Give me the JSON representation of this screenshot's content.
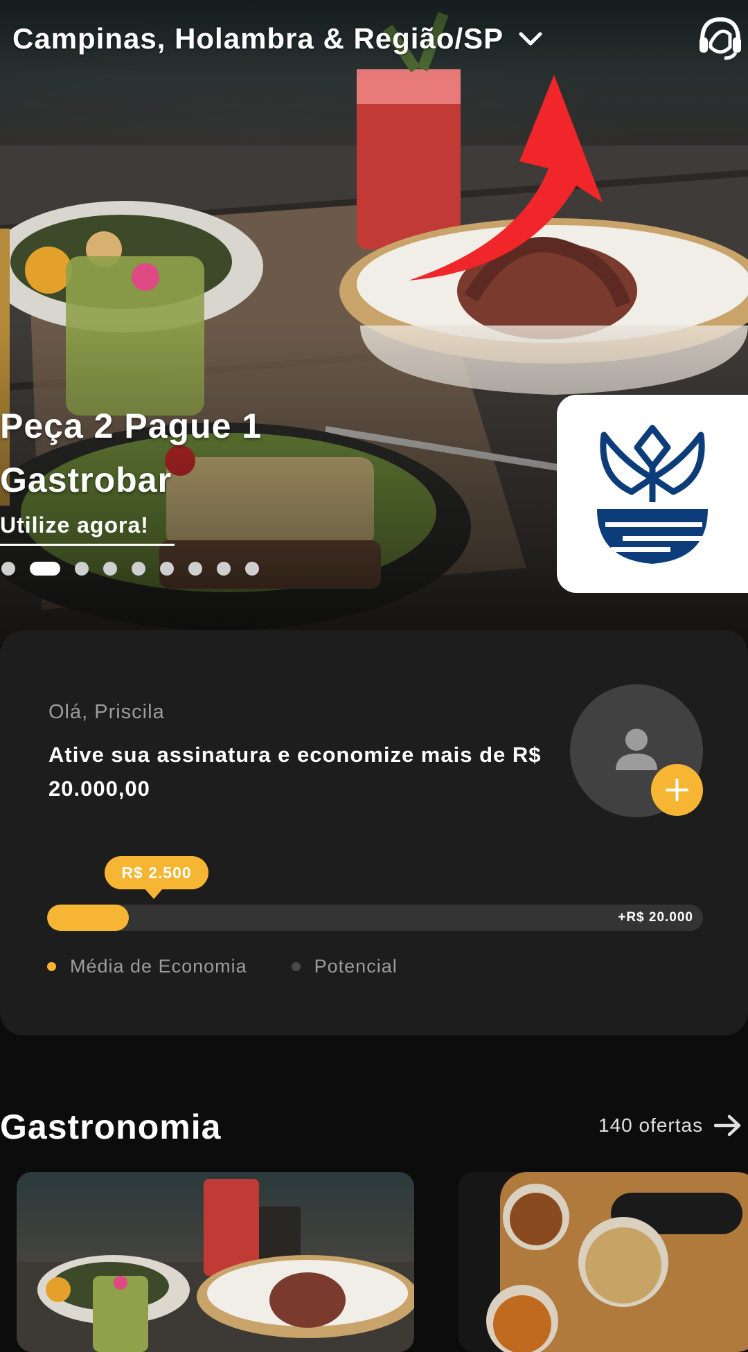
{
  "header": {
    "location": "Campinas, Holambra & Região/SP",
    "location_icon": "chevron-down-icon",
    "support_icon": "headset-support-icon"
  },
  "promo": {
    "title_line1": "Peça 2 Pague 1",
    "title_line2": "Gastrobar",
    "link": "Utilize agora!",
    "slides_total": 9,
    "active_slide": 2,
    "brand_logo_color": "#0c3d7a"
  },
  "savings": {
    "greeting": "Olá, Priscila",
    "headline": "Ative sua assinatura e economize mais de  R$ 20.000,00",
    "current_label": "R$ 2.500",
    "max_label": "+R$ 20.000",
    "progress_fraction": 0.125,
    "legend": [
      {
        "label": "Média de Economia",
        "color": "#f6b532"
      },
      {
        "label": "Potencial",
        "color": "#4a4a4a"
      }
    ],
    "avatar_icon": "user-avatar-icon",
    "add_icon": "plus-icon"
  },
  "section": {
    "title": "Gastronomia",
    "count_label": "140 ofertas",
    "arrow_icon": "arrow-right-icon"
  },
  "colors": {
    "accent": "#f6b532",
    "card_bg": "#1d1d1e",
    "page_bg": "#0c0c0c",
    "annotation_arrow": "#f0262a"
  }
}
